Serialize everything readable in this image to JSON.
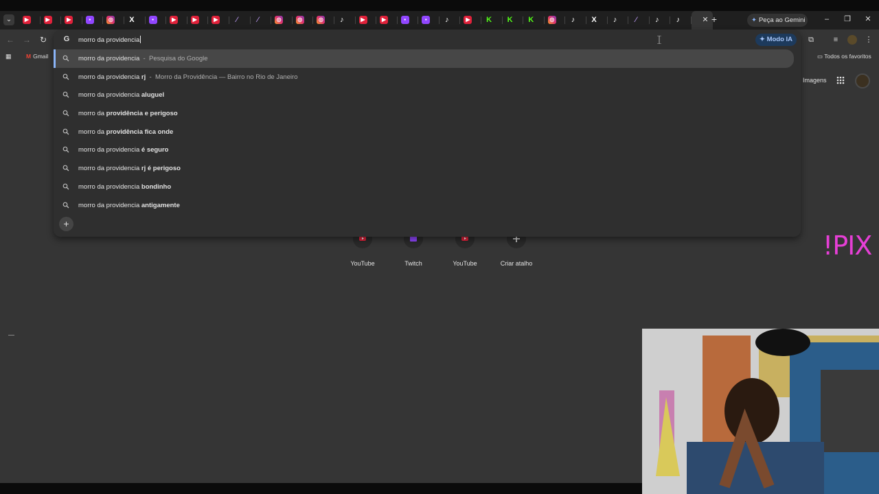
{
  "tabs": {
    "menu_icon": "chevron-down-icon",
    "items": [
      {
        "icon": "youtube"
      },
      {
        "icon": "youtube"
      },
      {
        "icon": "youtube"
      },
      {
        "icon": "twitch"
      },
      {
        "icon": "instagram"
      },
      {
        "icon": "x"
      },
      {
        "icon": "twitch"
      },
      {
        "icon": "youtube"
      },
      {
        "icon": "youtube"
      },
      {
        "icon": "youtube"
      },
      {
        "icon": "feather"
      },
      {
        "icon": "feather"
      },
      {
        "icon": "instagram"
      },
      {
        "icon": "instagram"
      },
      {
        "icon": "instagram"
      },
      {
        "icon": "tiktok"
      },
      {
        "icon": "youtube"
      },
      {
        "icon": "youtube"
      },
      {
        "icon": "twitch"
      },
      {
        "icon": "twitch"
      },
      {
        "icon": "tiktok"
      },
      {
        "icon": "youtube"
      },
      {
        "icon": "kick"
      },
      {
        "icon": "kick"
      },
      {
        "icon": "kick"
      },
      {
        "icon": "instagram"
      },
      {
        "icon": "tiktok"
      },
      {
        "icon": "x"
      },
      {
        "icon": "tiktok"
      },
      {
        "icon": "feather"
      },
      {
        "icon": "tiktok"
      },
      {
        "icon": "tiktok"
      },
      {
        "icon": "close",
        "active": true
      }
    ],
    "gemini_button": "Peça ao Gemini"
  },
  "omnibox": {
    "query": "morro da providencia",
    "ai_mode_label": "Modo IA",
    "suggestions": [
      {
        "prefix": "morro da providencia",
        "bold": "",
        "desc_sep": "-",
        "desc": "Pesquisa do Google",
        "selected": true
      },
      {
        "prefix": "morro da providencia ",
        "bold": "rj",
        "desc_sep": "-",
        "desc": "Morro da Providência — Bairro no Rio de Janeiro"
      },
      {
        "prefix": "morro da providencia ",
        "bold": "aluguel"
      },
      {
        "prefix": "morro da ",
        "bold": "providência e perigoso"
      },
      {
        "prefix": "morro da ",
        "bold": "providência fica onde"
      },
      {
        "prefix": "morro da providencia ",
        "bold": "é seguro"
      },
      {
        "prefix": "morro da providencia ",
        "bold": "rj é perigoso"
      },
      {
        "prefix": "morro da providencia ",
        "bold": "bondinho"
      },
      {
        "prefix": "morro da providencia ",
        "bold": "antigamente"
      }
    ]
  },
  "bookmarks": {
    "gmail_label": "Gmail",
    "favorites_label": "Todos os favoritos"
  },
  "ntp": {
    "images_link": "Imagens",
    "shortcuts": [
      {
        "label": "YouTube",
        "icon": "youtube"
      },
      {
        "label": "Twitch",
        "icon": "twitch"
      },
      {
        "label": "YouTube",
        "icon": "youtube"
      },
      {
        "label": "Criar atalho",
        "icon": "plus"
      }
    ]
  },
  "overlay": {
    "pix_text": "!PIX"
  },
  "colors": {
    "background": "#353535",
    "tabstrip": "#1f1f1f",
    "omnibox": "#2f2f2f",
    "accent_blue": "#8ab4f8",
    "pix_magenta": "#e63fd6"
  }
}
